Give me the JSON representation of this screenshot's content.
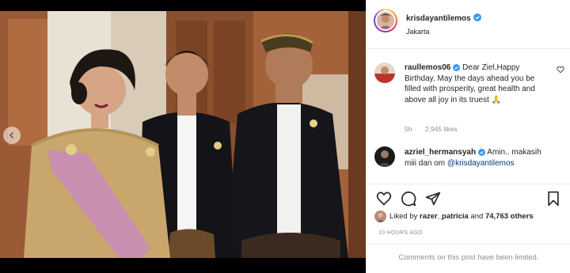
{
  "header": {
    "username": "krisdayantilemos",
    "location": "Jakarta"
  },
  "comments": [
    {
      "username": "raullemos06",
      "text": "Dear Ziel,Happy Birthday. May the days ahead you be filled with prosperity, great health and above all joy in its truest 🙏",
      "age": "5h",
      "likes": "2,945 likes"
    },
    {
      "username": "azriel_hermansyah",
      "text": "Amin.. makasih miii dan om",
      "mention": "@krisdayantilemos"
    }
  ],
  "likes": {
    "prefix": "Liked by",
    "user": "razer_patricia",
    "joiner": "and",
    "others": "74,763 others"
  },
  "timestamp": "10 HOURS AGO",
  "comments_limited": "Comments on this post have been limited.",
  "colors": {
    "verified": "#3897f0",
    "link": "#00376b",
    "muted": "#8e8e8e",
    "sash": "#c98fb0",
    "kebaya": "#c9a66b"
  },
  "icons": [
    "chevron-left-icon",
    "verified-badge-icon",
    "heart-icon",
    "comment-icon",
    "share-icon",
    "bookmark-icon"
  ]
}
